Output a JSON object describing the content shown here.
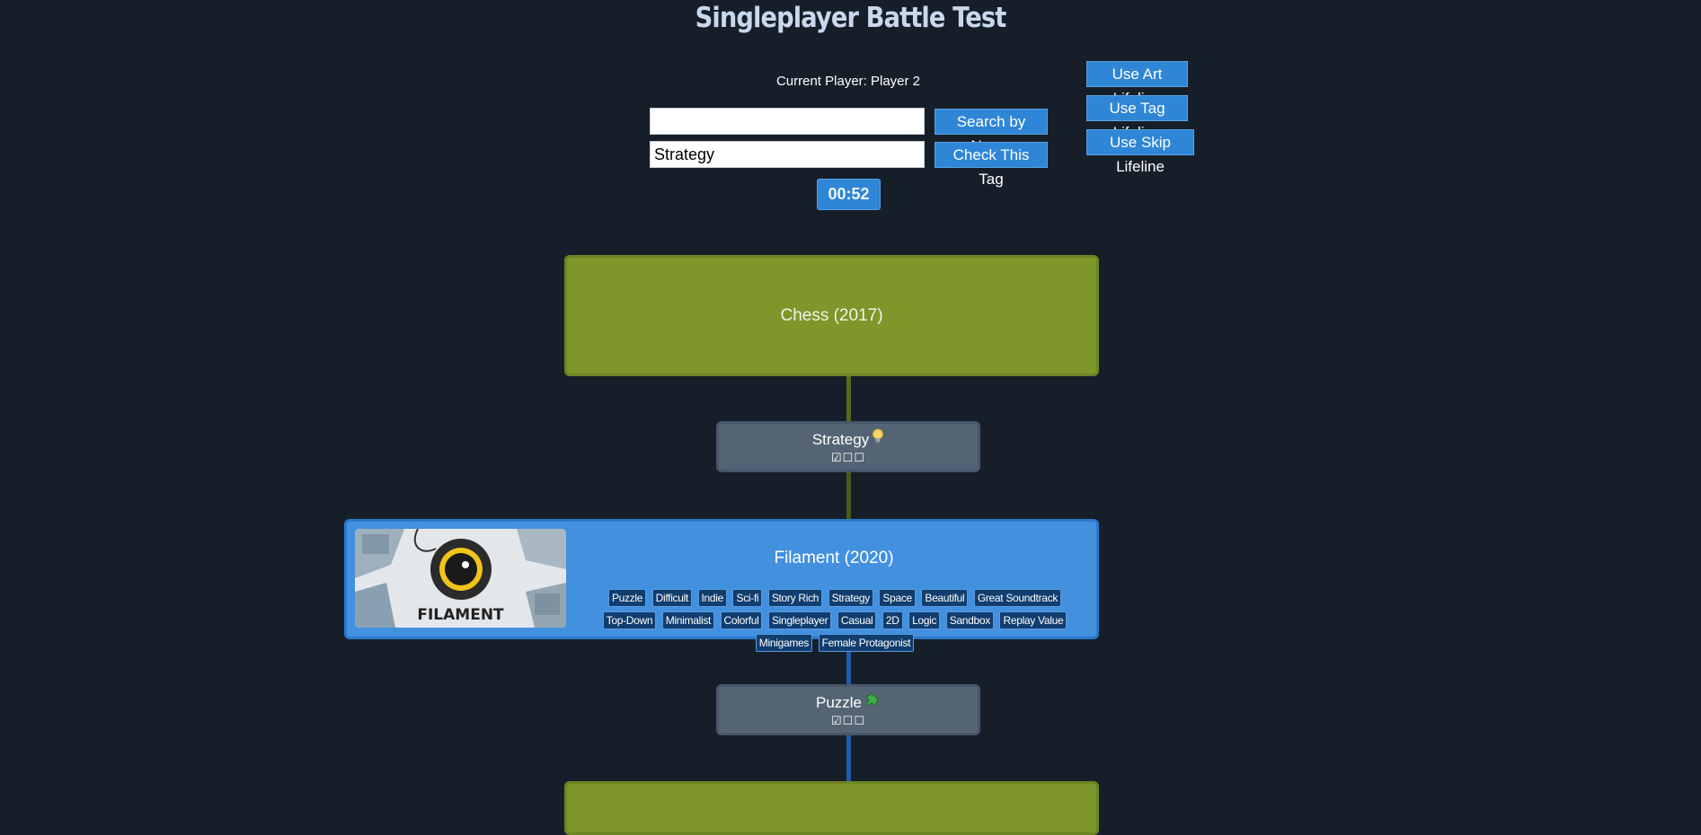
{
  "page": {
    "title": "Singleplayer Battle Test"
  },
  "status": {
    "current_player": "Current Player: Player 2"
  },
  "search": {
    "name_value": "",
    "tag_value": "Strategy",
    "search_by_name_label": "Search by Name",
    "check_tag_label": "Check This Tag"
  },
  "lifelines": {
    "art": "Use Art Lifeline",
    "tag": "Use Tag Lifeline",
    "skip": "Use Skip Lifeline"
  },
  "timer": {
    "value": "00:52"
  },
  "chain": {
    "start_game": "Chess (2017)",
    "link1": {
      "tag": "Strategy",
      "icon": "lightbulb-icon",
      "checks": "☑☐☐"
    },
    "current_game": {
      "title": "Filament (2020)",
      "cover_text": "FILAMENT",
      "tags": [
        "Puzzle",
        "Difficult",
        "Indie",
        "Sci-fi",
        "Story Rich",
        "Strategy",
        "Space",
        "Beautiful",
        "Great Soundtrack",
        "Top-Down",
        "Minimalist",
        "Colorful",
        "Singleplayer",
        "Casual",
        "2D",
        "Logic",
        "Sandbox",
        "Replay Value",
        "Minigames",
        "Female Protagonist"
      ]
    },
    "link2": {
      "tag": "Puzzle",
      "icon": "puzzle-piece-icon",
      "checks": "☑☐☐"
    }
  },
  "colors": {
    "background": "#161f29",
    "game_node_green": "#7f962b",
    "game_node_blue": "#4390df",
    "tag_node": "#556474",
    "button": "#2f86d6",
    "tag_chip": "#113d6f"
  }
}
